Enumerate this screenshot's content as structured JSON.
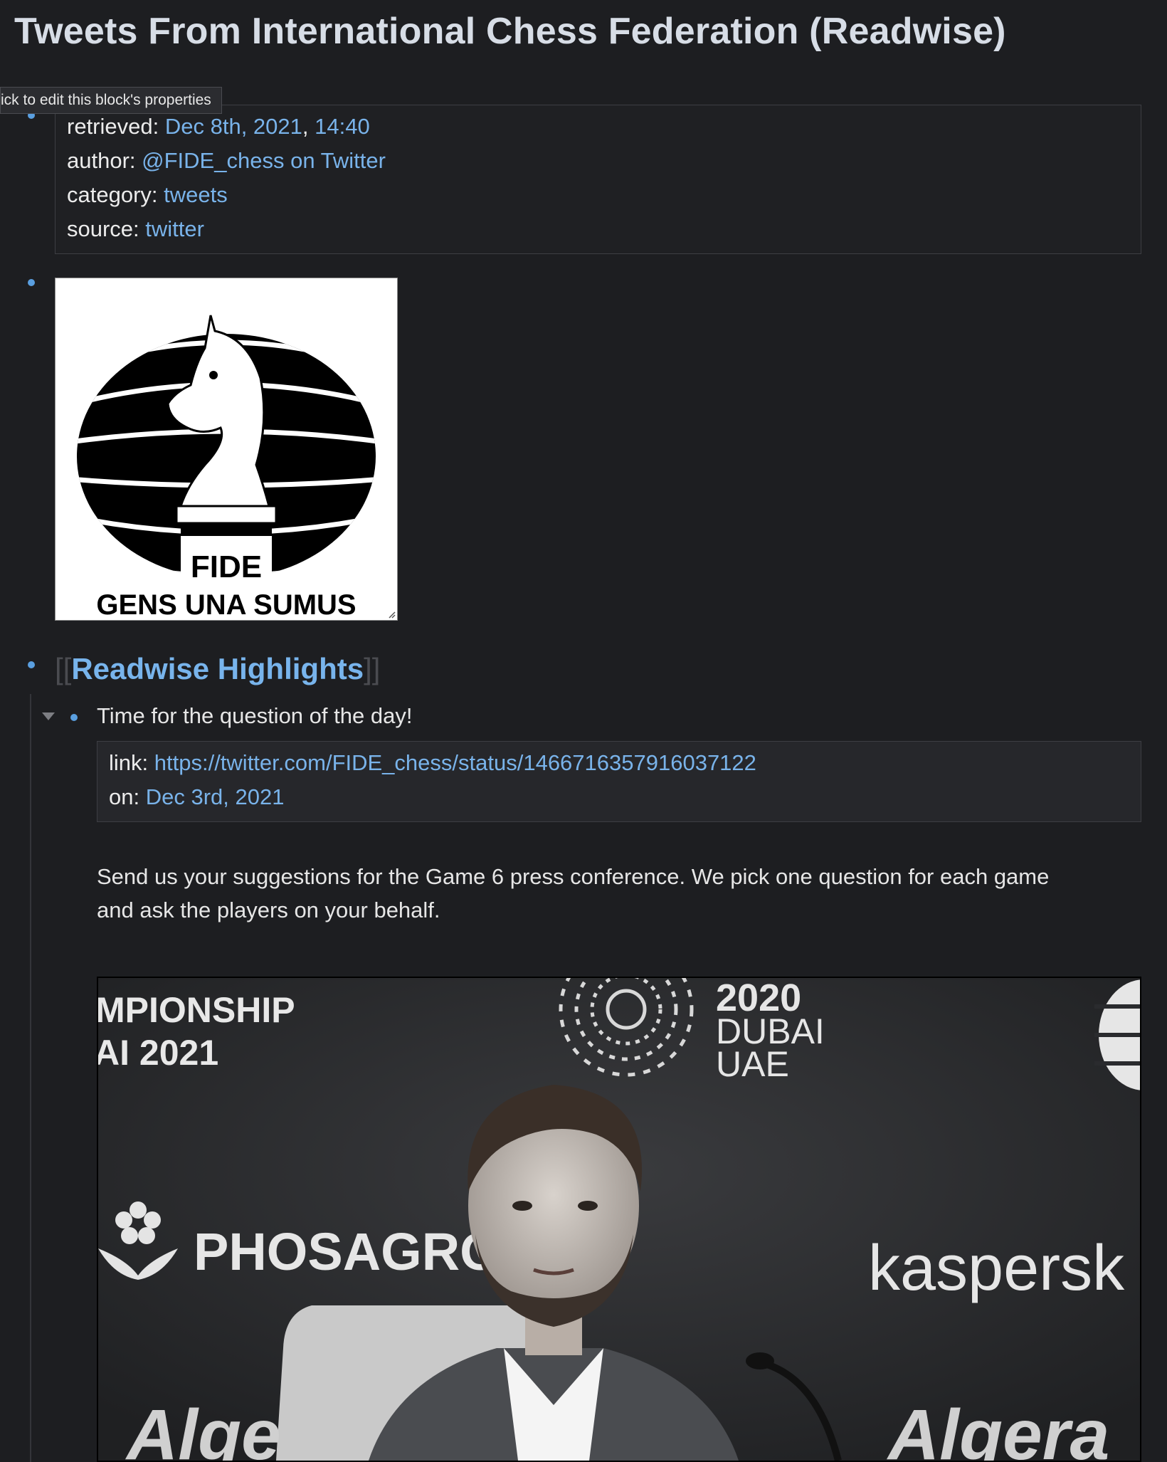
{
  "page": {
    "title": "Tweets From International Chess Federation (Readwise)"
  },
  "tooltip": {
    "text": "ick to edit this block's properties"
  },
  "properties": {
    "retrieved_key": "retrieved",
    "retrieved_date": "Dec 8th, 2021",
    "retrieved_sep": ",",
    "retrieved_time": "14:40",
    "author_key": "author",
    "author_value": "@FIDE_chess on Twitter",
    "category_key": "category",
    "category_value": "tweets",
    "source_key": "source",
    "source_value": "twitter",
    "colon": ":"
  },
  "logo": {
    "text_line1": "FIDE",
    "text_line2": "GENS UNA SUMUS"
  },
  "highlights": {
    "open_brackets": "[[",
    "page_link": "Readwise Highlights",
    "close_brackets": "]]"
  },
  "highlight_item": {
    "title": "Time for the question of the day!",
    "link_key": "link",
    "link_value": "https://twitter.com/FIDE_chess/status/1466716357916037122",
    "on_key": "on",
    "on_value": "Dec 3rd, 2021",
    "body_line1": "Send us your suggestions for the Game 6 press conference. We pick one question for each game",
    "body_line2": "and ask the players on your behalf."
  },
  "photo": {
    "banner_line1": "MPIONSHIP",
    "banner_line2": "AI 2021",
    "expo_line1": "2020",
    "expo_line2": "DUBAI",
    "expo_line3": "UAE",
    "sponsor1": "PHOSAGRO",
    "sponsor2": "kaspersk",
    "sponsor3": "Alge",
    "sponsor4": "Algera"
  },
  "colors": {
    "background": "#1d1e21",
    "link": "#79b3ea",
    "bullet": "#5a9fe0",
    "text": "#e6e6e6"
  }
}
